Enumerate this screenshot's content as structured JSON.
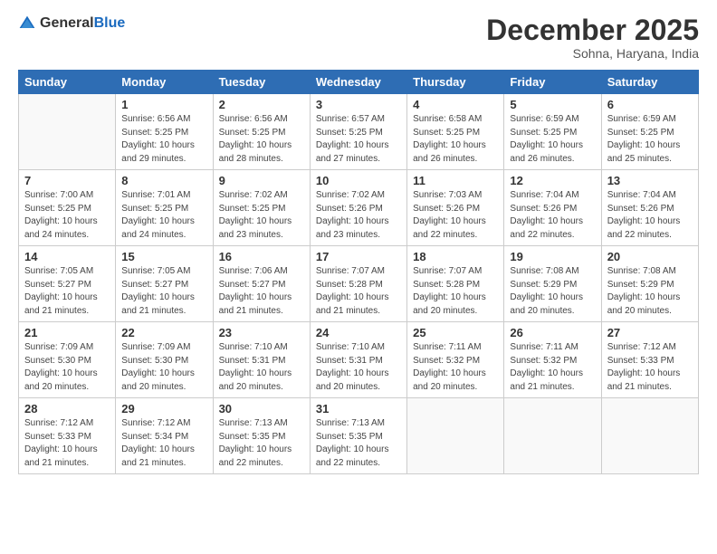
{
  "header": {
    "logo": {
      "general": "General",
      "blue": "Blue"
    },
    "title": "December 2025",
    "location": "Sohna, Haryana, India"
  },
  "weekdays": [
    "Sunday",
    "Monday",
    "Tuesday",
    "Wednesday",
    "Thursday",
    "Friday",
    "Saturday"
  ],
  "weeks": [
    [
      {
        "day": "",
        "info": ""
      },
      {
        "day": "1",
        "info": "Sunrise: 6:56 AM\nSunset: 5:25 PM\nDaylight: 10 hours\nand 29 minutes."
      },
      {
        "day": "2",
        "info": "Sunrise: 6:56 AM\nSunset: 5:25 PM\nDaylight: 10 hours\nand 28 minutes."
      },
      {
        "day": "3",
        "info": "Sunrise: 6:57 AM\nSunset: 5:25 PM\nDaylight: 10 hours\nand 27 minutes."
      },
      {
        "day": "4",
        "info": "Sunrise: 6:58 AM\nSunset: 5:25 PM\nDaylight: 10 hours\nand 26 minutes."
      },
      {
        "day": "5",
        "info": "Sunrise: 6:59 AM\nSunset: 5:25 PM\nDaylight: 10 hours\nand 26 minutes."
      },
      {
        "day": "6",
        "info": "Sunrise: 6:59 AM\nSunset: 5:25 PM\nDaylight: 10 hours\nand 25 minutes."
      }
    ],
    [
      {
        "day": "7",
        "info": "Sunrise: 7:00 AM\nSunset: 5:25 PM\nDaylight: 10 hours\nand 24 minutes."
      },
      {
        "day": "8",
        "info": "Sunrise: 7:01 AM\nSunset: 5:25 PM\nDaylight: 10 hours\nand 24 minutes."
      },
      {
        "day": "9",
        "info": "Sunrise: 7:02 AM\nSunset: 5:25 PM\nDaylight: 10 hours\nand 23 minutes."
      },
      {
        "day": "10",
        "info": "Sunrise: 7:02 AM\nSunset: 5:26 PM\nDaylight: 10 hours\nand 23 minutes."
      },
      {
        "day": "11",
        "info": "Sunrise: 7:03 AM\nSunset: 5:26 PM\nDaylight: 10 hours\nand 22 minutes."
      },
      {
        "day": "12",
        "info": "Sunrise: 7:04 AM\nSunset: 5:26 PM\nDaylight: 10 hours\nand 22 minutes."
      },
      {
        "day": "13",
        "info": "Sunrise: 7:04 AM\nSunset: 5:26 PM\nDaylight: 10 hours\nand 22 minutes."
      }
    ],
    [
      {
        "day": "14",
        "info": "Sunrise: 7:05 AM\nSunset: 5:27 PM\nDaylight: 10 hours\nand 21 minutes."
      },
      {
        "day": "15",
        "info": "Sunrise: 7:05 AM\nSunset: 5:27 PM\nDaylight: 10 hours\nand 21 minutes."
      },
      {
        "day": "16",
        "info": "Sunrise: 7:06 AM\nSunset: 5:27 PM\nDaylight: 10 hours\nand 21 minutes."
      },
      {
        "day": "17",
        "info": "Sunrise: 7:07 AM\nSunset: 5:28 PM\nDaylight: 10 hours\nand 21 minutes."
      },
      {
        "day": "18",
        "info": "Sunrise: 7:07 AM\nSunset: 5:28 PM\nDaylight: 10 hours\nand 20 minutes."
      },
      {
        "day": "19",
        "info": "Sunrise: 7:08 AM\nSunset: 5:29 PM\nDaylight: 10 hours\nand 20 minutes."
      },
      {
        "day": "20",
        "info": "Sunrise: 7:08 AM\nSunset: 5:29 PM\nDaylight: 10 hours\nand 20 minutes."
      }
    ],
    [
      {
        "day": "21",
        "info": "Sunrise: 7:09 AM\nSunset: 5:30 PM\nDaylight: 10 hours\nand 20 minutes."
      },
      {
        "day": "22",
        "info": "Sunrise: 7:09 AM\nSunset: 5:30 PM\nDaylight: 10 hours\nand 20 minutes."
      },
      {
        "day": "23",
        "info": "Sunrise: 7:10 AM\nSunset: 5:31 PM\nDaylight: 10 hours\nand 20 minutes."
      },
      {
        "day": "24",
        "info": "Sunrise: 7:10 AM\nSunset: 5:31 PM\nDaylight: 10 hours\nand 20 minutes."
      },
      {
        "day": "25",
        "info": "Sunrise: 7:11 AM\nSunset: 5:32 PM\nDaylight: 10 hours\nand 20 minutes."
      },
      {
        "day": "26",
        "info": "Sunrise: 7:11 AM\nSunset: 5:32 PM\nDaylight: 10 hours\nand 21 minutes."
      },
      {
        "day": "27",
        "info": "Sunrise: 7:12 AM\nSunset: 5:33 PM\nDaylight: 10 hours\nand 21 minutes."
      }
    ],
    [
      {
        "day": "28",
        "info": "Sunrise: 7:12 AM\nSunset: 5:33 PM\nDaylight: 10 hours\nand 21 minutes."
      },
      {
        "day": "29",
        "info": "Sunrise: 7:12 AM\nSunset: 5:34 PM\nDaylight: 10 hours\nand 21 minutes."
      },
      {
        "day": "30",
        "info": "Sunrise: 7:13 AM\nSunset: 5:35 PM\nDaylight: 10 hours\nand 22 minutes."
      },
      {
        "day": "31",
        "info": "Sunrise: 7:13 AM\nSunset: 5:35 PM\nDaylight: 10 hours\nand 22 minutes."
      },
      {
        "day": "",
        "info": ""
      },
      {
        "day": "",
        "info": ""
      },
      {
        "day": "",
        "info": ""
      }
    ]
  ]
}
